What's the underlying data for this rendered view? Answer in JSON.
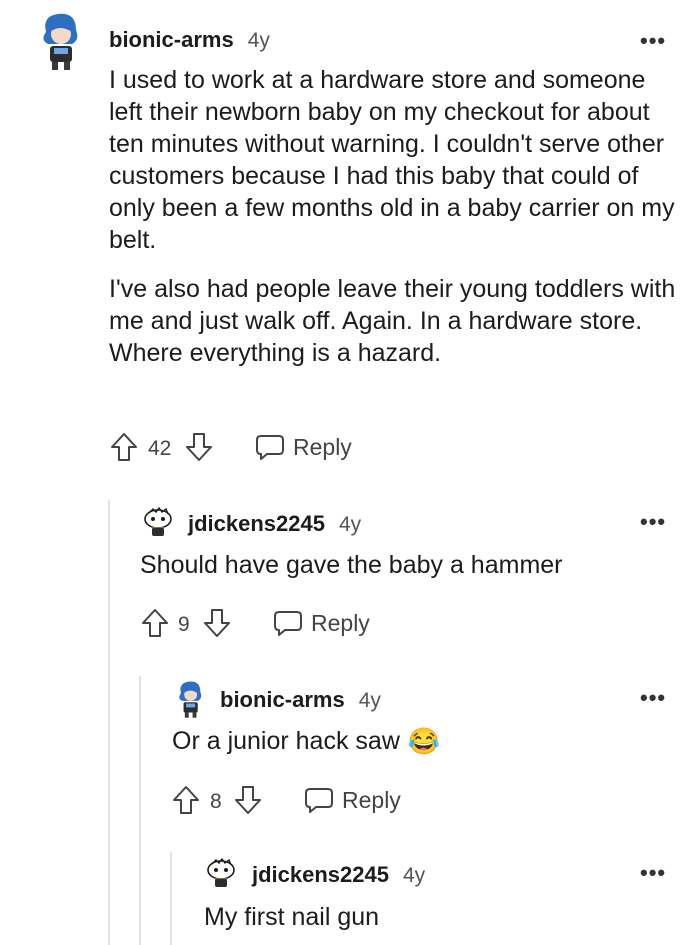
{
  "comments": [
    {
      "author": "bionic-arms",
      "age": "4y",
      "paragraphs": [
        "I used to work at a hardware store and someone left their newborn baby on my checkout for about ten minutes without warning. I couldn't serve other customers because I had this baby that could of only been a few months old in a baby carrier on my belt.",
        "I've also had people leave their young toddlers with me and just walk off. Again. In a hardware store. Where everything is a hazard."
      ],
      "votes": "42",
      "reply_label": "Reply",
      "more_label": "•••"
    },
    {
      "author": "jdickens2245",
      "age": "4y",
      "text": "Should have gave the baby a hammer",
      "votes": "9",
      "reply_label": "Reply",
      "more_label": "•••"
    },
    {
      "author": "bionic-arms",
      "age": "4y",
      "text": "Or a junior hack saw",
      "emoji": "😂",
      "votes": "8",
      "reply_label": "Reply",
      "more_label": "•••"
    },
    {
      "author": "jdickens2245",
      "age": "4y",
      "text": "My first nail gun",
      "more_label": "•••"
    }
  ],
  "colors": {
    "text": "#1c1c1c",
    "meta": "#555555",
    "thread_line": "#e3e3e3",
    "avatar_blue": "#2e6fc4"
  }
}
